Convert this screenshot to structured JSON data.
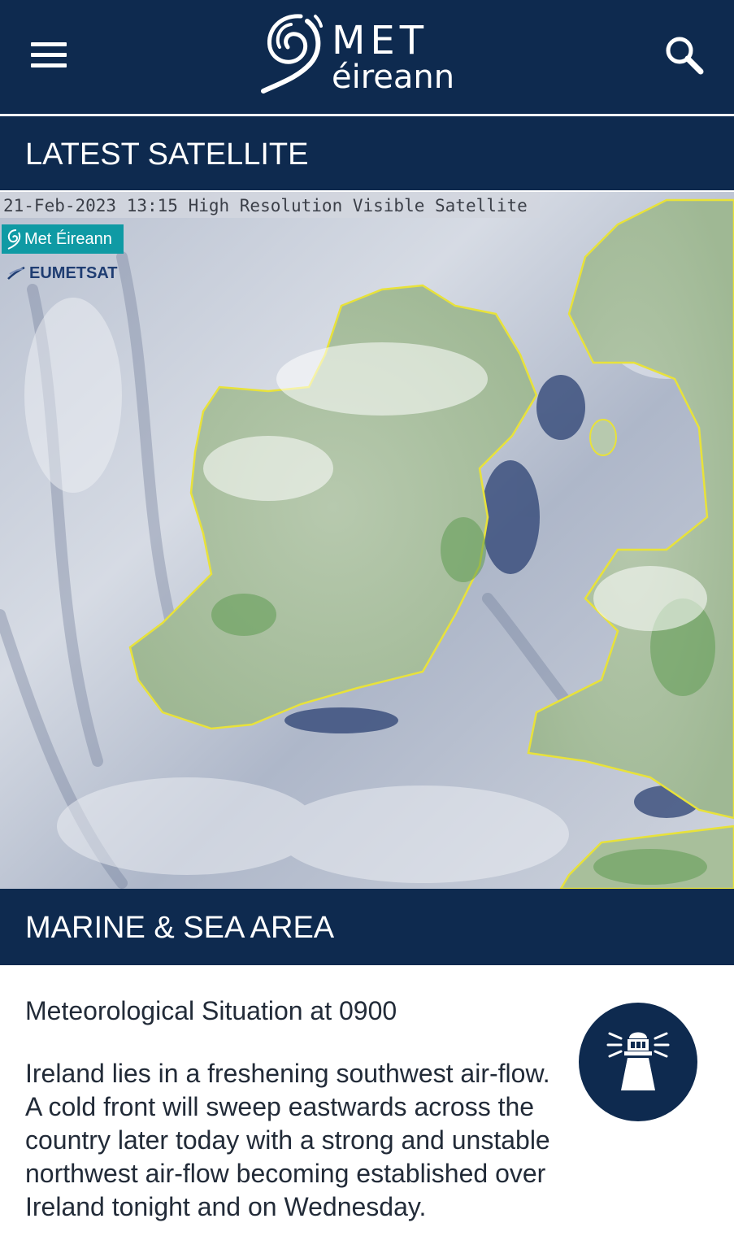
{
  "header": {
    "logo_top": "MET",
    "logo_bottom": "éireann"
  },
  "icons": {
    "menu": "hamburger-menu-icon",
    "search": "search-icon",
    "logo": "swirl-logo-icon",
    "marine": "lighthouse-icon"
  },
  "satellite": {
    "section_title": "LATEST SATELLITE",
    "caption": "21-Feb-2023 13:15 High Resolution Visible Satellite",
    "badge_met": "Met Éireann",
    "badge_eumetsat": "EUMETSAT"
  },
  "marine": {
    "section_title": "MARINE & SEA AREA",
    "situation_title": "Meteorological Situation at 0900",
    "situation_text": "Ireland lies in a freshening southwest air-flow. A cold front will sweep eastwards across the country later today with a strong and unstable northwest air-flow becoming established over Ireland tonight and on Wednesday."
  },
  "colors": {
    "brand_navy": "#0e2a4f",
    "badge_teal": "#0f9aa4",
    "coast_yellow": "#e8e23a"
  }
}
